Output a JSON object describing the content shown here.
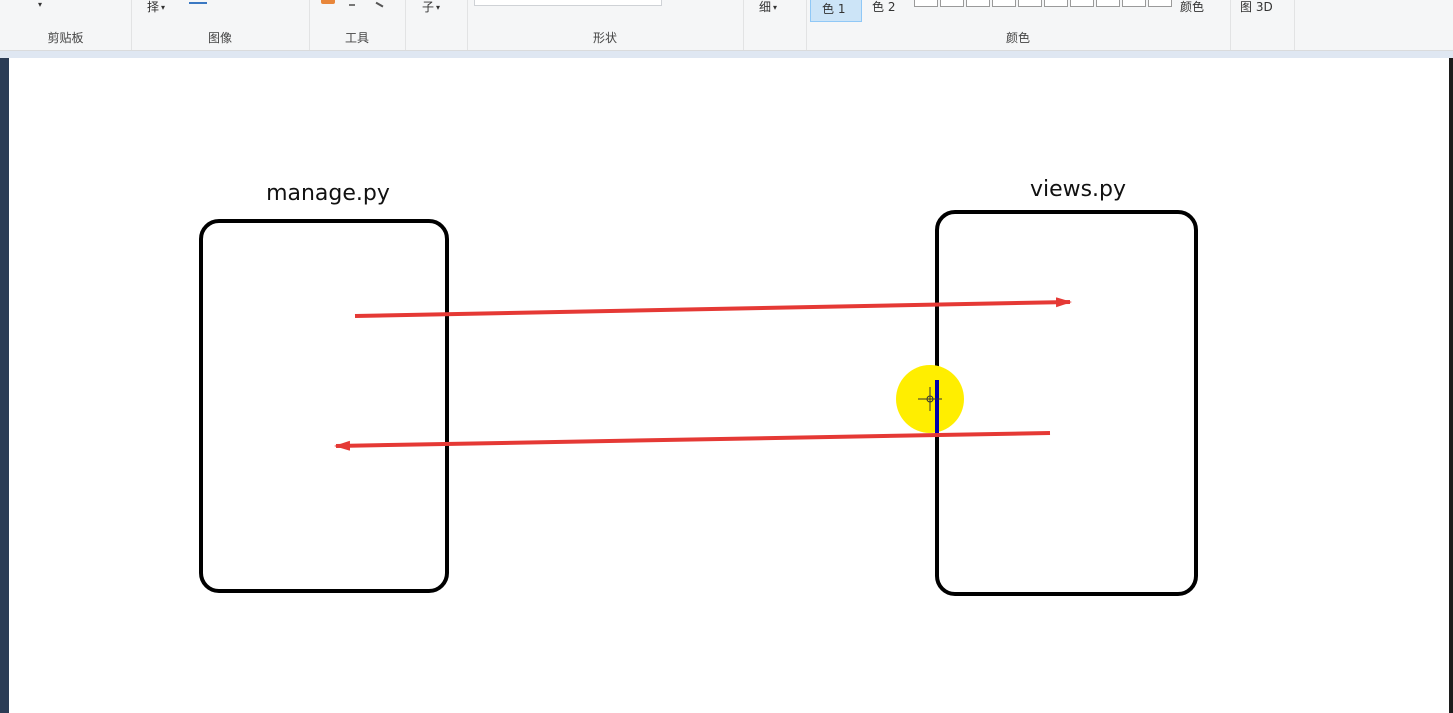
{
  "ribbon": {
    "clipboard": {
      "label": "剪贴板"
    },
    "image": {
      "label": "图像",
      "select_partial": "择"
    },
    "tools": {
      "label": "工具"
    },
    "brushes": {
      "partial": "子"
    },
    "shapes": {
      "label": "形状"
    },
    "size": {
      "partial": "细"
    },
    "colors": {
      "label": "颜色",
      "color1": "色 1",
      "color2": "色 2",
      "edit_colors_partial": "颜色"
    },
    "paint3d": {
      "partial": "图 3D"
    }
  },
  "canvas": {
    "box_left_label": "manage.py",
    "box_right_label": "views.py",
    "arrow_color": "#e53935",
    "cursor_highlight_color": "#ffee00"
  }
}
